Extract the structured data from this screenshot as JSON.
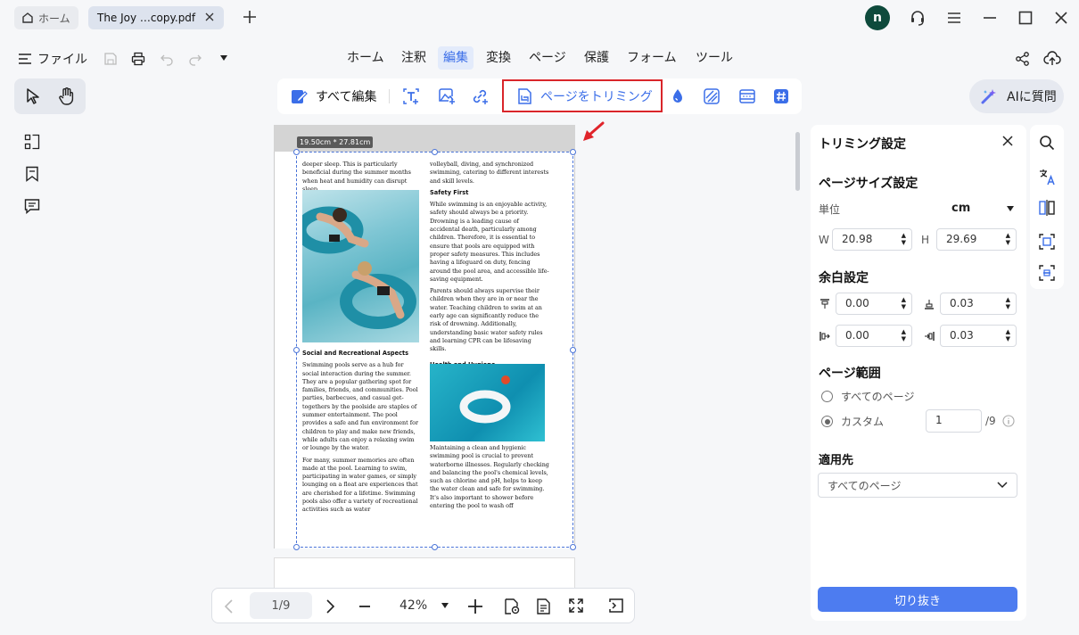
{
  "window": {
    "home_tab": "ホーム",
    "doc_tab": "The Joy …copy.pdf",
    "avatar_letter": "n"
  },
  "menubar": {
    "file_label": "ファイル",
    "tabs": [
      "ホーム",
      "注釈",
      "編集",
      "変換",
      "ページ",
      "保護",
      "フォーム",
      "ツール"
    ],
    "active_tab": "編集"
  },
  "toolbar": {
    "edit_all_label": "すべて編集",
    "crop_page_label": "ページをトリミング",
    "ai_label": "AIに質問"
  },
  "document": {
    "size_label": "19.50cm * 27.81cm",
    "col1_p1": "deeper sleep. This is particularly beneficial during the summer months when heat and humidity can disrupt sleep.",
    "col1_h1": "Social and Recreational Aspects",
    "col1_p2": "Swimming pools serve as a hub for social interaction during the summer. They are a popular gathering spot for families, friends, and communities. Pool parties, barbecues, and casual get-togethers by the poolside are staples of summer entertainment. The pool provides a safe and fun environment for children to play and make new friends, while adults can enjoy a relaxing swim or lounge by the water.",
    "col1_p3": "For many, summer memories are often made at the pool. Learning to swim, participating in water games, or simply lounging on a float are experiences that are cherished for a lifetime. Swimming pools also offer a variety of recreational activities such as water",
    "col2_p1": "volleyball, diving, and synchronized swimming, catering to different interests and skill levels.",
    "col2_h1": "Safety First",
    "col2_p2": "While swimming is an enjoyable activity, safety should always be a priority. Drowning is a leading cause of accidental death, particularly among children. Therefore, it is essential to ensure that pools are equipped with proper safety measures. This includes having a lifeguard on duty, fencing around the pool area, and accessible life-saving equipment.",
    "col2_p3": "Parents should always supervise their children when they are in or near the water. Teaching children to swim at an early age can significantly reduce the risk of drowning. Additionally, understanding basic water safety rules and learning CPR can be lifesaving skills.",
    "col2_h2": "Health and Hygiene",
    "col2_p4": "Maintaining a clean and hygienic swimming pool is crucial to prevent waterborne illnesses. Regularly checking and balancing the pool's chemical levels, such as chlorine and pH, helps to keep the water clean and safe for swimming. It's also important to shower before entering the pool to wash off"
  },
  "nav": {
    "page_indicator": "1/9",
    "zoom": "42%"
  },
  "panel": {
    "title": "トリミング設定",
    "page_size_heading": "ページサイズ設定",
    "unit_label": "単位",
    "unit_value": "cm",
    "w_label": "W",
    "w_value": "20.98",
    "h_label": "H",
    "h_value": "29.69",
    "margin_heading": "余白設定",
    "margin_top": "0.00",
    "margin_bottom": "0.03",
    "margin_left": "0.00",
    "margin_right": "0.03",
    "range_heading": "ページ範囲",
    "all_pages_label": "すべてのページ",
    "custom_label": "カスタム",
    "custom_value": "1",
    "custom_total": "/9",
    "apply_heading": "適用先",
    "apply_value": "すべてのページ",
    "crop_button": "切り抜き"
  },
  "colors": {
    "accent": "#4d7cf0",
    "highlight_border": "#d9252a",
    "avatar_bg": "#0e4a3c"
  }
}
